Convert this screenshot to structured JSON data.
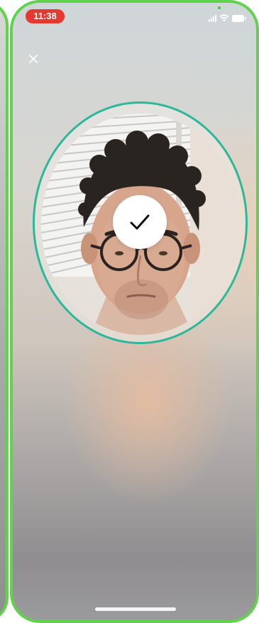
{
  "status_bar": {
    "time": "11:38",
    "icons": [
      "signal-icon",
      "wifi-icon",
      "battery-icon"
    ]
  },
  "controls": {
    "close_icon": "close-icon"
  },
  "capture": {
    "ring_color": "#2bb89a",
    "status_icon": "checkmark-icon",
    "state": "success"
  },
  "colors": {
    "frame": "#5fd34a",
    "time_pill": "#e5382e"
  }
}
